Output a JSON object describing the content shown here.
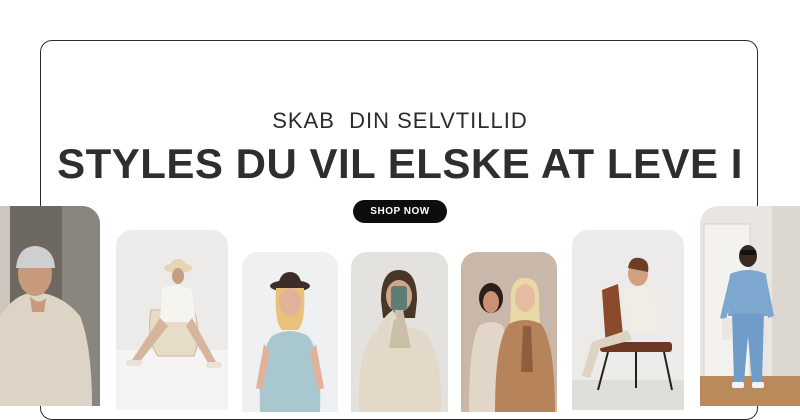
{
  "banner": {
    "subtitle": "SKAB  DIN SELVTILLID",
    "headline": "STYLES DU VIL ELSKE AT LEVE I",
    "cta_label": "SHOP NOW"
  },
  "colors": {
    "frame": "#2c2c2c",
    "text": "#2e2e2e",
    "button": "#0d0d0d",
    "button_text": "#ffffff"
  }
}
